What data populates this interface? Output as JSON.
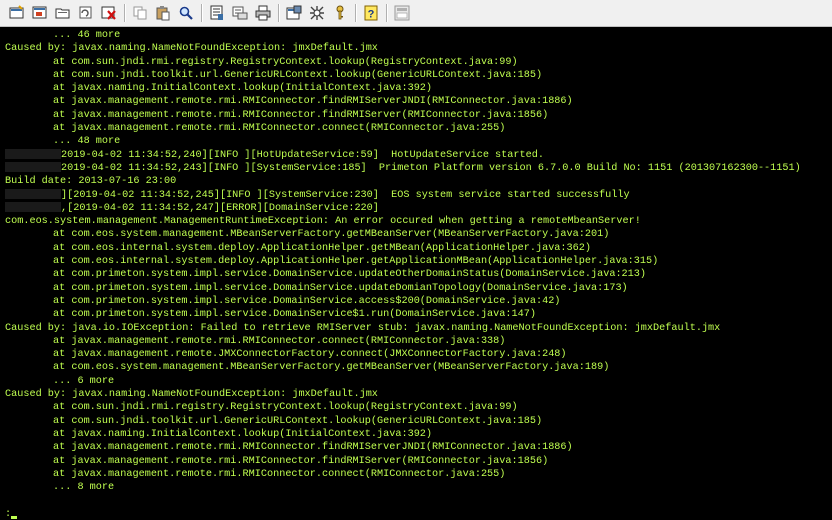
{
  "toolbar": {
    "buttons": [
      {
        "name": "new-session-icon",
        "icon": "new-session-icon"
      },
      {
        "name": "open-session-icon",
        "icon": "open-session-icon"
      },
      {
        "name": "folder-icon",
        "icon": "folder-icon"
      },
      {
        "name": "reconnect-icon",
        "icon": "reconnect-icon"
      },
      {
        "name": "disconnect-icon",
        "icon": "disconnect-icon"
      },
      {
        "name": "copy-icon",
        "icon": "copy-icon"
      },
      {
        "name": "paste-icon",
        "icon": "paste-icon"
      },
      {
        "name": "find-icon",
        "icon": "find-icon"
      },
      {
        "name": "log-icon",
        "icon": "log-icon"
      },
      {
        "name": "print-setup-icon",
        "icon": "print-setup-icon"
      },
      {
        "name": "print-icon",
        "icon": "print-icon"
      },
      {
        "name": "properties-icon",
        "icon": "properties-icon"
      },
      {
        "name": "settings-icon",
        "icon": "settings-icon"
      },
      {
        "name": "key-icon",
        "icon": "key-icon"
      },
      {
        "name": "help-icon",
        "icon": "help-icon"
      },
      {
        "name": "sftp-icon",
        "icon": "sftp-icon"
      }
    ]
  },
  "terminal": {
    "colors": {
      "background": "#000000",
      "text": "#c0ff50"
    },
    "lines": [
      {
        "indent": 1,
        "text": "... 46 more"
      },
      {
        "indent": 0,
        "text": "Caused by: javax.naming.NameNotFoundException: jmxDefault.jmx"
      },
      {
        "indent": 1,
        "text": "at com.sun.jndi.rmi.registry.RegistryContext.lookup(RegistryContext.java:99)"
      },
      {
        "indent": 1,
        "text": "at com.sun.jndi.toolkit.url.GenericURLContext.lookup(GenericURLContext.java:185)"
      },
      {
        "indent": 1,
        "text": "at javax.naming.InitialContext.lookup(InitialContext.java:392)"
      },
      {
        "indent": 1,
        "text": "at javax.management.remote.rmi.RMIConnector.findRMIServerJNDI(RMIConnector.java:1886)"
      },
      {
        "indent": 1,
        "text": "at javax.management.remote.rmi.RMIConnector.findRMIServer(RMIConnector.java:1856)"
      },
      {
        "indent": 1,
        "text": "at javax.management.remote.rmi.RMIConnector.connect(RMIConnector.java:255)"
      },
      {
        "indent": 1,
        "text": "... 48 more"
      },
      {
        "indent": 0,
        "redact": true,
        "text": "2019-04-02 11:34:52,240][INFO ][HotUpdateService:59]  HotUpdateService started."
      },
      {
        "indent": 0,
        "redact": true,
        "text": "2019-04-02 11:34:52,243][INFO ][SystemService:185]  Primeton Platform version 6.7.0.0 Build No: 1151 (201307162300--1151)"
      },
      {
        "indent": 0,
        "text": "Build date: 2013-07-16 23:00"
      },
      {
        "indent": 0,
        "redact": true,
        "text": "][2019-04-02 11:34:52,245][INFO ][SystemService:230]  EOS system service started successfully"
      },
      {
        "indent": 0,
        "redact": true,
        "text": ",[2019-04-02 11:34:52,247][ERROR][DomainService:220]"
      },
      {
        "indent": 0,
        "text": "com.eos.system.management.ManagementRuntimeException: An error occured when getting a remoteMbeanServer!"
      },
      {
        "indent": 1,
        "text": "at com.eos.system.management.MBeanServerFactory.getMBeanServer(MBeanServerFactory.java:201)"
      },
      {
        "indent": 1,
        "text": "at com.eos.internal.system.deploy.ApplicationHelper.getMBean(ApplicationHelper.java:362)"
      },
      {
        "indent": 1,
        "text": "at com.eos.internal.system.deploy.ApplicationHelper.getApplicationMBean(ApplicationHelper.java:315)"
      },
      {
        "indent": 1,
        "text": "at com.primeton.system.impl.service.DomainService.updateOtherDomainStatus(DomainService.java:213)"
      },
      {
        "indent": 1,
        "text": "at com.primeton.system.impl.service.DomainService.updateDomianTopology(DomainService.java:173)"
      },
      {
        "indent": 1,
        "text": "at com.primeton.system.impl.service.DomainService.access$200(DomainService.java:42)"
      },
      {
        "indent": 1,
        "text": "at com.primeton.system.impl.service.DomainService$1.run(DomainService.java:147)"
      },
      {
        "indent": 0,
        "text": "Caused by: java.io.IOException: Failed to retrieve RMIServer stub: javax.naming.NameNotFoundException: jmxDefault.jmx"
      },
      {
        "indent": 1,
        "text": "at javax.management.remote.rmi.RMIConnector.connect(RMIConnector.java:338)"
      },
      {
        "indent": 1,
        "text": "at javax.management.remote.JMXConnectorFactory.connect(JMXConnectorFactory.java:248)"
      },
      {
        "indent": 1,
        "text": "at com.eos.system.management.MBeanServerFactory.getMBeanServer(MBeanServerFactory.java:189)"
      },
      {
        "indent": 1,
        "text": "... 6 more"
      },
      {
        "indent": 0,
        "text": "Caused by: javax.naming.NameNotFoundException: jmxDefault.jmx"
      },
      {
        "indent": 1,
        "text": "at com.sun.jndi.rmi.registry.RegistryContext.lookup(RegistryContext.java:99)"
      },
      {
        "indent": 1,
        "text": "at com.sun.jndi.toolkit.url.GenericURLContext.lookup(GenericURLContext.java:185)"
      },
      {
        "indent": 1,
        "text": "at javax.naming.InitialContext.lookup(InitialContext.java:392)"
      },
      {
        "indent": 1,
        "text": "at javax.management.remote.rmi.RMIConnector.findRMIServerJNDI(RMIConnector.java:1886)"
      },
      {
        "indent": 1,
        "text": "at javax.management.remote.rmi.RMIConnector.findRMIServer(RMIConnector.java:1856)"
      },
      {
        "indent": 1,
        "text": "at javax.management.remote.rmi.RMIConnector.connect(RMIConnector.java:255)"
      },
      {
        "indent": 1,
        "text": "... 8 more"
      }
    ],
    "prompt": ":"
  }
}
